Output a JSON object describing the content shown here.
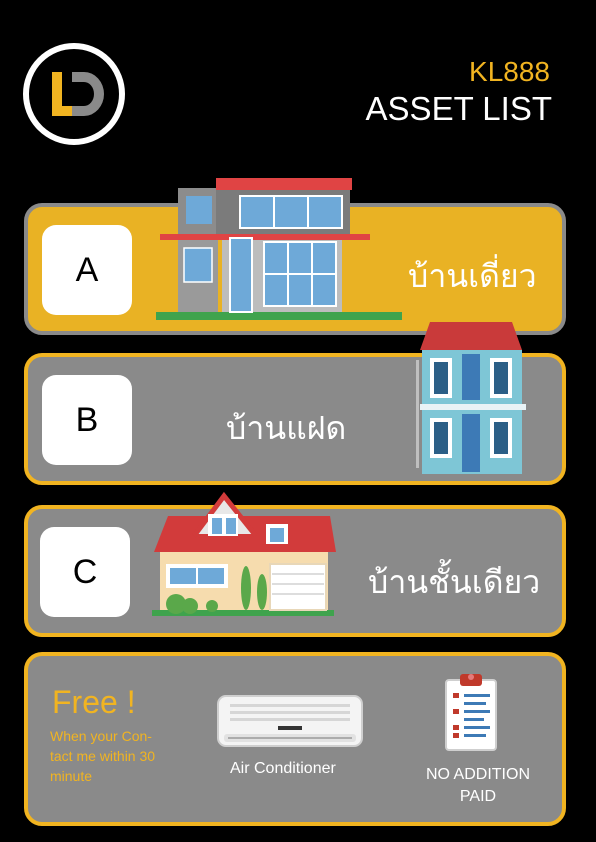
{
  "logo": {
    "text": "LD"
  },
  "header": {
    "code": "KL888",
    "title": "ASSET LIST"
  },
  "assets": [
    {
      "letter": "A",
      "label": "บ้านเดี่ยว"
    },
    {
      "letter": "B",
      "label": "บ้านแฝด"
    },
    {
      "letter": "C",
      "label": "บ้านชั้นเดียว"
    }
  ],
  "promo": {
    "title": "Free !",
    "text_line1": "When your Con-",
    "text_line2": "tact me within 30",
    "text_line3": "minute",
    "ac_label": "Air Conditioner",
    "paid_line1": "NO ADDITION",
    "paid_line2": "PAID"
  },
  "colors": {
    "accent": "#f1b421",
    "card_grey": "#8a8a8a",
    "background": "#000000"
  }
}
